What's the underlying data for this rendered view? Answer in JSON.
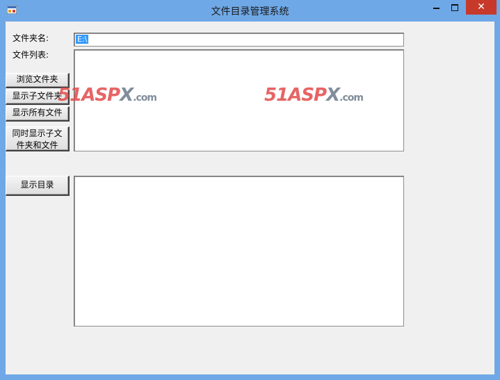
{
  "window": {
    "title": "文件目录管理系统"
  },
  "labels": {
    "folder_name": "文件夹名:",
    "file_list": "文件列表:"
  },
  "folder_input": {
    "value": "E:\\"
  },
  "buttons": {
    "browse": "浏览文件夹",
    "show_subfolders": "显示子文件夹",
    "show_all_files": "显示所有文件",
    "show_both_line1": "同时显示子文",
    "show_both_line2": "件夹和文件",
    "show_directory": "显示目录"
  },
  "watermark": {
    "brand_num": "51",
    "brand_a": "A",
    "brand_sp": "SP",
    "brand_x": "X",
    "suffix": ".com"
  },
  "colors": {
    "titlebar": "#6fa8e6",
    "close": "#c7392b",
    "client": "#f0f0f0",
    "selection": "#3399ff"
  }
}
